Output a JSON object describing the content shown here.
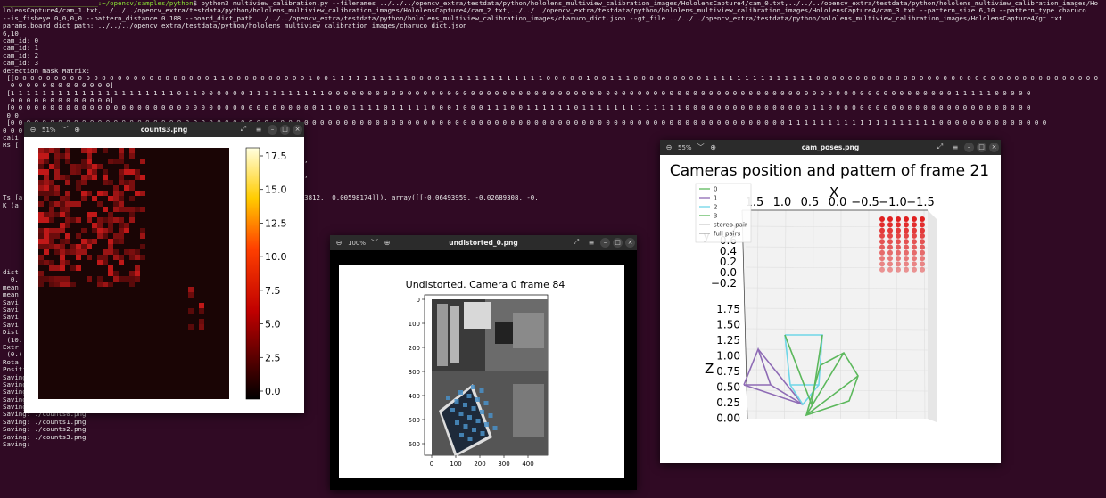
{
  "terminal": {
    "lines": [
      {
        "prompt": "________________________:~/opencv/samples/python",
        "text": "$ python3 multiview_calibration.py --filenames ../../../opencv_extra/testdata/python/hololens_multiview_calibration_images/HololensCapture4/cam_0.txt,../../../opencv_extra/testdata/python/hololens_multiview_calibration_images/Ho"
      },
      {
        "text": "lolensCapture4/cam_1.txt,../../../opencv_extra/testdata/python/hololens_multiview_calibration_images/HololensCapture4/cam_2.txt,../../../opencv_extra/testdata/python/hololens_multiview_calibration_images/HololensCapture4/cam_3.txt --pattern_size 6,10 --pattern_type charuco"
      },
      {
        "text": "--is_fisheye 0,0,0,0 --pattern_distance 0.108 --board_dict_path ../../../opencv_extra/testdata/python/hololens_multiview_calibration_images/charuco_dict.json --gt_file ../../../opencv_extra/testdata/python/hololens_multiview_calibration_images/HololensCapture4/gt.txt"
      },
      {
        "text": "params.board_dict_path: ../../../opencv_extra/testdata/python/hololens_multiview_calibration_images/charuco_dict.json"
      },
      {
        "text": "6,10"
      },
      {
        "text": "cam_id: 0"
      },
      {
        "text": "cam_id: 1"
      },
      {
        "text": "cam_id: 2"
      },
      {
        "text": "cam_id: 3"
      },
      {
        "text": "detection mask Matrix:"
      },
      {
        "text": " [[0 0 0 0 0 0 0 0 0 0 0 0 0 0 0 0 0 0 0 0 0 0 0 0 0 1 1 0 0 0 0 0 0 0 0 0 0 1 0 0 1 1 1 1 1 1 1 1 1 1 0 0 0 0 1 1 1 1 1 1 1 1 1 1 1 1 1 0 0 0 0 0 1 0 0 1 1 1 0 0 0 0 0 0 0 0 0 1 1 1 1 1 1 1 1 1 1 1 1 1 1 0 0 0 0 0 0 0 0 0 0 0 0 0 0 0 0 0 0 0 0 0 0 0 0 0 0 0 0 0 0 0 0 0 0 0 0"
      },
      {
        "text": "  0 0 0 0 0 0 0 0 0 0 0 0 0]"
      },
      {
        "text": " [1 1 1 1 1 1 1 1 1 1 1 1 1 1 1 1 1 1 1 1 1 0 1 1 0 0 0 0 0 0 1 1 1 1 1 1 1 1 1 1 0 0 0 0 0 0 0 0 0 0 0 0 0 0 0 0 0 0 0 0 0 0 0 0 0 0 0 0 0 0 0 0 0 0 0 0 0 0 0 0 0 0 0 0 0 0 0 0 0 0 0 0 0 0 0 0 0 0 0 0 0 0 0 0 0 0 0 0 0 0 0 0 0 0 0 0 0 0 0 1 1 1 1 1 0 0 0 0 0"
      },
      {
        "text": "  0 0 0 0 0 0 0 0 0 0 0 0 0]"
      },
      {
        "text": " [0 0 0 0 0 0 0 0 0 0 0 0 0 0 0 0 0 0 0 0 0 0 0 0 0 0 0 0 0 0 0 0 0 0 0 0 0 0 0 1 1 0 0 1 1 1 1 0 1 1 1 1 1 0 0 0 1 0 0 0 1 1 1 0 0 1 1 1 1 1 1 0 1 1 1 1 1 1 1 1 1 1 1 1 1 0 0 0 0 0 0 0 0 0 0 0 0 0 0 0 0 1 1 0 0 0 0 0 0 0 0 0 0 0 0 0 0 0 0 0 0 0 0 0 0 0 0 0 0"
      },
      {
        "text": " 0 0"
      },
      {
        "text": " [0 0 0 0 0 0 0 0 0 0 0 0 0 0 0 0 0 0 0 0 0 0 0 0 0 0 0 0 0 0 0 0 0 0 0 0 0 0 0 0 0 0 0 0 0 0 0 0 0 0 0 0 0 0 0 0 0 0 0 0 0 0 0 0 0 0 0 0 0 0 0 0 0 0 0 0 0 0 0 0 0 0 0 0 0 0 0 0 0 0 0 0 0 0 0 0 0 0 1 1 1 1 1 1 1 1 1 1 1 1 1 1 1 1 1 1 1 0 0 0 0 0 0 0 0 0 0 0 0 0 0"
      },
      {
        "text": "0 0 0"
      },
      {
        "text": "cali"
      },
      {
        "text": "Rs ["
      },
      {
        "text": ""
      },
      {
        "text": "                                            8.96787133e-03, -4.60144132e-02],"
      },
      {
        "text": ""
      },
      {
        "text": "                                            85917, -0.0271737 , -0.85075522],"
      },
      {
        "text": ""
      },
      {
        "text": ""
      },
      {
        "text": "Ts [a                                         . array([[-0.1021762 ,  0.00543812,  0.00598174]]), array([[-0.06493959, -0.02689308, -0."
      },
      {
        "text": "K (a"
      },
      {
        "text": ""
      },
      {
        "text": "                                            0."
      },
      {
        "text": ""
      },
      {
        "text": "                                            0."
      },
      {
        "text": ""
      },
      {
        "text": "                                            0."
      },
      {
        "text": ""
      },
      {
        "text": ""
      },
      {
        "text": "dist                                        008263                                                                                           5]]),                                                                          0.01497157,  0.00447093,"
      },
      {
        "text": "  0."
      },
      {
        "text": "mean"
      },
      {
        "text": "mean"
      },
      {
        "text": "Savi"
      },
      {
        "text": "Savi"
      },
      {
        "text": "Savi"
      },
      {
        "text": "Savi"
      },
      {
        "text": "Dist"
      },
      {
        "text": " (10."
      },
      {
        "text": "Extr"
      },
      {
        "text": " (0.("
      },
      {
        "text": "Rota"
      },
      {
        "text": "Position error (mean, median): (0.000, 0.000)"
      },
      {
        "text": "Saving: cam_poses.png"
      },
      {
        "text": "Saving: undistorted_0.png"
      },
      {
        "text": "Saving: undistorted_1.png"
      },
      {
        "text": "Saving: undistorted_2.png"
      },
      {
        "text": "Saving: undistorted_3.png"
      },
      {
        "text": "Saving: ./counts0.png"
      },
      {
        "text": "Saving: ./counts1.png"
      },
      {
        "text": "Saving: ./counts2.png"
      },
      {
        "text": "Saving: ./counts3.png"
      },
      {
        "text": "Saving:"
      }
    ]
  },
  "windows": {
    "counts": {
      "title": "counts3.png",
      "zoom": "51%",
      "colorbar_ticks": [
        "17.5",
        "15.0",
        "12.5",
        "10.0",
        "7.5",
        "5.0",
        "2.5",
        "0.0"
      ]
    },
    "undistorted": {
      "title": "undistorted_0.png",
      "zoom": "100%",
      "plot_title": "Undistorted. Camera 0 frame 84",
      "y_ticks": [
        "0",
        "100",
        "200",
        "300",
        "400",
        "500",
        "600"
      ],
      "x_ticks": [
        "0",
        "100",
        "200",
        "300",
        "400"
      ]
    },
    "poses": {
      "title": "cam_poses.png",
      "zoom": "55%",
      "plot_title": "Cameras position and pattern of frame 21",
      "x_axis_label": "X",
      "y_axis_label": "y",
      "z_axis_label": "Z",
      "x_ticks": [
        "1.5",
        "1.0",
        "0.5",
        "0.0",
        "−0.5",
        "−1.0",
        "−1.5"
      ],
      "y_ticks": [
        "2",
        "0.6",
        "0.4",
        "0.2",
        "0.0",
        "−0.2"
      ],
      "z_ticks": [
        "1.75",
        "1.50",
        "1.25",
        "1.00",
        "0.75",
        "0.50",
        "0.25",
        "0.00"
      ],
      "legend": [
        {
          "label": "0",
          "color": "#5cb85c"
        },
        {
          "label": "1",
          "color": "#8e6bb5"
        },
        {
          "label": "2",
          "color": "#6fd6e8"
        },
        {
          "label": "3",
          "color": "#5cb85c"
        },
        {
          "label": "stereo pair",
          "color": "#cccccc"
        },
        {
          "label": "full pairs",
          "color": "#aaaaaa"
        }
      ]
    }
  }
}
